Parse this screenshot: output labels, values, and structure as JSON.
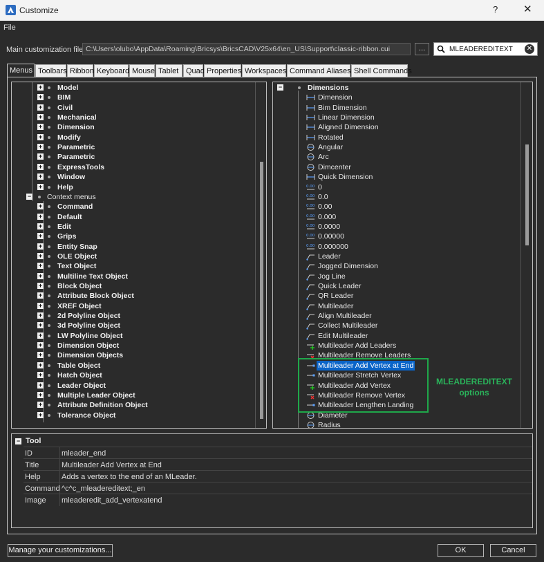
{
  "window": {
    "title": "Customize",
    "help_glyph": "?",
    "close_glyph": "✕"
  },
  "menubar": {
    "file": "File"
  },
  "main_file": {
    "label": "Main customization file:",
    "path": "C:\\Users\\olubo\\AppData\\Roaming\\Bricsys\\BricsCAD\\V25x64\\en_US\\Support\\classic-ribbon.cui",
    "browse_label": "...",
    "search_value": "MLEADEREDITEXT"
  },
  "tabs": [
    "Menus",
    "Toolbars",
    "Ribbon",
    "Keyboard",
    "Mouse",
    "Tablet",
    "Quad",
    "Properties",
    "Workspaces",
    "Command Aliases",
    "Shell Commands"
  ],
  "left_tree": {
    "top_items": [
      "Model",
      "BIM",
      "Civil",
      "Mechanical",
      "Dimension",
      "Modify",
      "Parametric",
      "Parametric",
      "ExpressTools",
      "Window",
      "Help"
    ],
    "context_menus_label": "Context menus",
    "context_items": [
      "Command",
      "Default",
      "Edit",
      "Grips",
      "Entity Snap",
      "OLE Object",
      "Text Object",
      "Multiline Text Object",
      "Block Object",
      "Attribute Block Object",
      "XREF Object",
      "2d Polyline Object",
      "3d Polyline Object",
      "LW Polyline Object",
      "Dimension Object",
      "Dimension Objects",
      "Table Object",
      "Hatch Object",
      "Leader Object",
      "Multiple Leader Object",
      "Attribute Definition Object",
      "Tolerance Object"
    ]
  },
  "right_tree": {
    "group_label": "Dimensions",
    "items": [
      {
        "label": "Dimension",
        "icon": "dimension-icon"
      },
      {
        "label": "Bim Dimension",
        "icon": "bim-dimension-icon"
      },
      {
        "label": "Linear Dimension",
        "icon": "linear-dimension-icon"
      },
      {
        "label": "Aligned Dimension",
        "icon": "aligned-dimension-icon"
      },
      {
        "label": "Rotated",
        "icon": "rotated-dimension-icon"
      },
      {
        "label": "Angular",
        "icon": "angular-dimension-icon"
      },
      {
        "label": "Arc",
        "icon": "arc-dimension-icon"
      },
      {
        "label": "Dimcenter",
        "icon": "dimcenter-icon"
      },
      {
        "label": "Quick Dimension",
        "icon": "quick-dimension-icon"
      },
      {
        "label": "0",
        "icon": "precision-icon"
      },
      {
        "label": "0.0",
        "icon": "precision-icon"
      },
      {
        "label": "0.00",
        "icon": "precision-icon"
      },
      {
        "label": "0.000",
        "icon": "precision-icon"
      },
      {
        "label": "0.0000",
        "icon": "precision-icon"
      },
      {
        "label": "0.00000",
        "icon": "precision-icon"
      },
      {
        "label": "0.000000",
        "icon": "precision-icon"
      },
      {
        "label": "Leader",
        "icon": "leader-icon"
      },
      {
        "label": "Jogged Dimension",
        "icon": "jogged-dimension-icon"
      },
      {
        "label": "Jog Line",
        "icon": "jog-line-icon"
      },
      {
        "label": "Quick Leader",
        "icon": "quick-leader-icon"
      },
      {
        "label": "QR Leader",
        "icon": "qr-leader-icon"
      },
      {
        "label": "Multileader",
        "icon": "multileader-icon"
      },
      {
        "label": "Align Multileader",
        "icon": "align-multileader-icon"
      },
      {
        "label": "Collect Multileader",
        "icon": "collect-multileader-icon"
      },
      {
        "label": "Edit Multileader",
        "icon": "edit-multileader-icon"
      },
      {
        "label": "Multileader Add Leaders",
        "icon": "add-leaders-icon"
      },
      {
        "label": "Multileader Remove Leaders",
        "icon": "remove-leaders-icon"
      },
      {
        "label": "Multileader Add Vertex at End",
        "icon": "add-vertex-end-icon"
      },
      {
        "label": "Multileader Stretch Vertex",
        "icon": "stretch-vertex-icon"
      },
      {
        "label": "Multileader Add Vertex",
        "icon": "add-vertex-icon"
      },
      {
        "label": "Multileader Remove Vertex",
        "icon": "remove-vertex-icon"
      },
      {
        "label": "Multileader Lengthen Landing",
        "icon": "lengthen-landing-icon"
      },
      {
        "label": "Diameter",
        "icon": "diameter-icon"
      },
      {
        "label": "Radius",
        "icon": "radius-icon"
      }
    ],
    "selected_index": 27
  },
  "annotation": {
    "line1": "MLEADEREDITEXT",
    "line2": "options",
    "color": "#1fa84a"
  },
  "properties": {
    "header": "Tool",
    "rows": [
      {
        "key": "ID",
        "value": "mleader_end"
      },
      {
        "key": "Title",
        "value": "Multileader Add Vertex at End"
      },
      {
        "key": "Help",
        "value": "Adds a vertex to the end of an MLeader."
      },
      {
        "key": "Command",
        "value": "^c^c_mleadereditext;_en"
      },
      {
        "key": "Image",
        "value": "mleaderedit_add_vertexatend"
      }
    ]
  },
  "buttons": {
    "manage": "Manage your customizations...",
    "ok": "OK",
    "cancel": "Cancel"
  },
  "colors": {
    "selection": "#0a64c8",
    "background": "#2b2b2b"
  }
}
